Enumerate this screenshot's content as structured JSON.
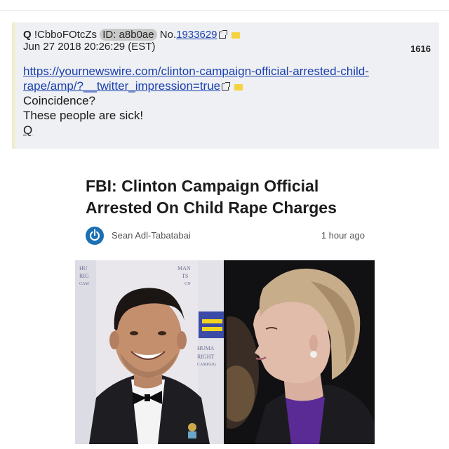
{
  "post": {
    "name": "Q",
    "tripcode": "!CbboFOtcZs",
    "id_label": "ID: a8b0ae",
    "no_label": "No.",
    "post_number": "1933629",
    "date": "Jun 27 2018 20:26:29 (EST)",
    "count": "1616",
    "link_line1": "https://yournewswire.com/clinton-campaign-official-arrested-child-",
    "link_line2": "rape/amp/?__twitter_impression=true",
    "line_coincidence": "Coincidence?",
    "line_sick": "These people are sick!",
    "signature": "Q"
  },
  "article": {
    "title_line1": "FBI: Clinton Campaign Official",
    "title_line2": "Arrested On Child Rape Charges",
    "author": "Sean Adl-Tabatabai",
    "time": "1 hour ago"
  },
  "backdrop": {
    "hrc_top": [
      "HU",
      "RIG",
      "CAM"
    ],
    "hrc_top_right": [
      "MAN",
      "TS",
      "GN"
    ],
    "hrc_bottom": [
      "HUMA",
      "RIGHT",
      "CAMPAIG"
    ]
  },
  "colors": {
    "post_bg": "#eef0f3",
    "link": "#1a3fb0",
    "logo_blue": "#1b6fb3",
    "hrc_yellow": "#f3d51f",
    "hrc_blue": "#3a4aa6"
  },
  "icons": [
    "external-link-icon",
    "folder-icon",
    "power-logo-icon"
  ]
}
